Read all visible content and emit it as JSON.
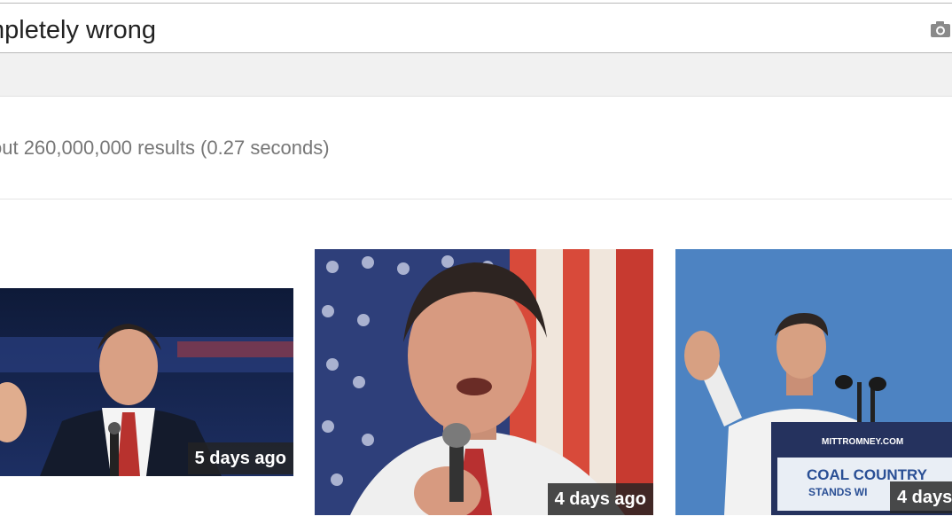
{
  "search": {
    "query": "mpletely wrong",
    "camera_icon": "camera-icon"
  },
  "results": {
    "stats": "out 260,000,000 results (0.27 seconds)"
  },
  "images": [
    {
      "age": "5 days ago"
    },
    {
      "age": "4 days ago"
    },
    {
      "age": "4 days"
    }
  ],
  "image_text": {
    "sign_line1": "MITTROMNEY.COM",
    "sign_line2": "COAL COUNTRY",
    "sign_line3": "STANDS WI"
  },
  "colors": {
    "badge_bg": "#232323",
    "stats_text": "#777777",
    "nav_strip": "#f1f1f1"
  }
}
